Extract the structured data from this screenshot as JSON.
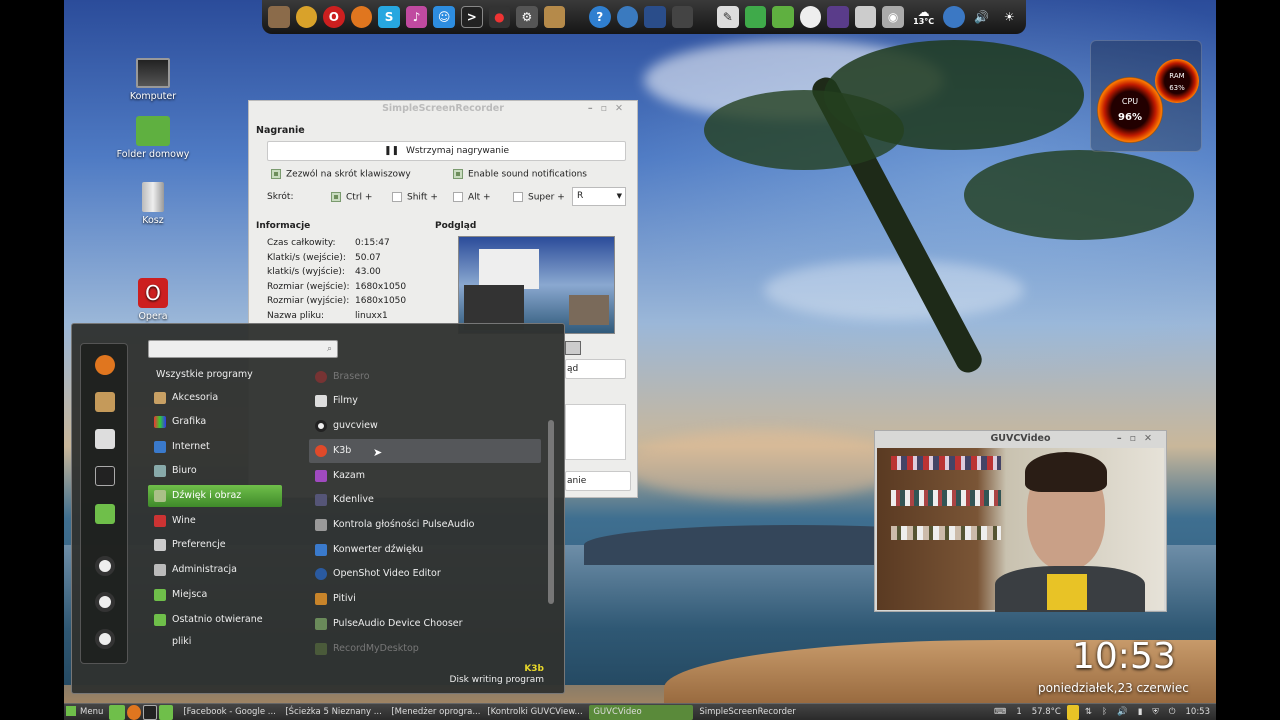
{
  "desktop": {
    "icons": [
      {
        "label": "Komputer",
        "icon": "computer-icon"
      },
      {
        "label": "Folder domowy",
        "icon": "home-folder-icon"
      },
      {
        "label": "Kosz",
        "icon": "trash-icon"
      },
      {
        "label": "Opera",
        "icon": "opera-icon"
      }
    ],
    "clock": "10:53",
    "date": "poniedziałek,23 czerwiec",
    "weather": "13°C",
    "cpu_gauge": {
      "label": "CPU",
      "value": "96%"
    },
    "ram_gauge": {
      "label": "RAM",
      "value": "63%"
    }
  },
  "recorder": {
    "title": "SimpleScreenRecorder",
    "section_recording": "Nagranie",
    "pause_button": "Wstrzymaj nagrywanie",
    "hotkey_checkbox": "Zezwól na skrót klawiszowy",
    "sound_checkbox": "Enable sound notifications",
    "shortcut_label": "Skrót:",
    "mod_ctrl": "Ctrl +",
    "mod_shift": "Shift +",
    "mod_alt": "Alt +",
    "mod_super": "Super +",
    "key_value": "R",
    "section_info": "Informacje",
    "section_preview": "Podgląd",
    "info_rows": [
      {
        "label": "Czas całkowity:",
        "value": "0:15:47"
      },
      {
        "label": "Klatki/s (wejście):",
        "value": "50.07"
      },
      {
        "label": "klatki/s (wyjście):",
        "value": "43.00"
      },
      {
        "label": "Rozmiar (wejście):",
        "value": "1680x1050"
      },
      {
        "label": "Rozmiar (wyjście):",
        "value": "1680x1050"
      },
      {
        "label": "Nazwa pliku:",
        "value": "linuxx1"
      }
    ],
    "partial_button_1": "ąd",
    "partial_button_2": "anie"
  },
  "webcam": {
    "title": "GUVCVideo"
  },
  "menu": {
    "search_placeholder": "",
    "categories": [
      {
        "label": "Wszystkie programy",
        "selected": false
      },
      {
        "label": "Akcesoria",
        "selected": false
      },
      {
        "label": "Grafika",
        "selected": false
      },
      {
        "label": "Internet",
        "selected": false
      },
      {
        "label": "Biuro",
        "selected": false
      },
      {
        "label": "Dźwięk i obraz",
        "selected": true
      },
      {
        "label": "Wine",
        "selected": false
      },
      {
        "label": "Preferencje",
        "selected": false
      },
      {
        "label": "Administracja",
        "selected": false
      },
      {
        "label": "Miejsca",
        "selected": false
      },
      {
        "label": "Ostatnio otwierane pliki",
        "selected": false
      }
    ],
    "apps": [
      {
        "label": "Brasero",
        "dim": true
      },
      {
        "label": "Filmy",
        "dim": false
      },
      {
        "label": "guvcview",
        "dim": false
      },
      {
        "label": "K3b",
        "dim": false,
        "selected": true
      },
      {
        "label": "Kazam",
        "dim": false
      },
      {
        "label": "Kdenlive",
        "dim": false
      },
      {
        "label": "Kontrola głośności PulseAudio",
        "dim": false
      },
      {
        "label": "Konwerter dźwięku",
        "dim": false
      },
      {
        "label": "OpenShot Video Editor",
        "dim": false
      },
      {
        "label": "Pitivi",
        "dim": false
      },
      {
        "label": "PulseAudio Device Chooser",
        "dim": false
      },
      {
        "label": "RecordMyDesktop",
        "dim": true
      }
    ],
    "selected_app_name": "K3b",
    "selected_app_desc": "Disk writing program"
  },
  "taskbar": {
    "menu_label": "Menu",
    "windows": [
      {
        "label": "[Facebook - Google ...",
        "active": false
      },
      {
        "label": "[Ścieżka 5 Nieznany ...",
        "active": false
      },
      {
        "label": "[Menedżer oprogra...",
        "active": false
      },
      {
        "label": "[Kontrolki GUVCView...",
        "active": false
      },
      {
        "label": "GUVCVideo",
        "active": true
      },
      {
        "label": "SimpleScreenRecorder",
        "active": false
      }
    ],
    "tray_workspace": "1",
    "tray_temp": "57.8°C",
    "tray_clock": "10:53"
  },
  "colors": {
    "accent_green": "#5fae3c",
    "opera_red": "#cc1f1f"
  }
}
